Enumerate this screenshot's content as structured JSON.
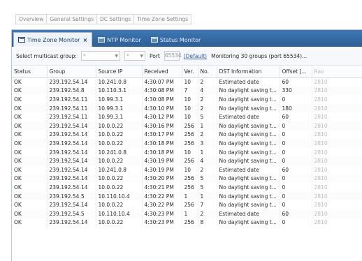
{
  "top_tabs": [
    "Overview",
    "General Settings",
    "DC Settings",
    "Time Zone Settings"
  ],
  "inner_tabs": [
    {
      "label": "Time Zone Monitor",
      "close": "×"
    },
    {
      "label": "NTP Monitor"
    },
    {
      "label": "Status Monitor"
    }
  ],
  "toolbar": {
    "select_label": "Select multicast group:",
    "combo1_value": "*",
    "combo2_value": "*",
    "port_label": "Port",
    "port_value": "65534",
    "default_link": "(Default)",
    "status_text": "Monitoring 30 groups (port 65534)..."
  },
  "table": {
    "columns": [
      "Status",
      "Group",
      "Source IP",
      "Received",
      "Ver.",
      "No.",
      "DST Information",
      "Offset [...",
      "Rav"
    ],
    "rows": [
      [
        "OK",
        "239.192.54.14",
        "10.241.0.8",
        "4:30:07 PM",
        "10",
        "2",
        "Estimated date",
        "60",
        "2810"
      ],
      [
        "OK",
        "239.192.54.8",
        "10.110.3.1",
        "4:30:08 PM",
        "7",
        "4",
        "No daylight saving t...",
        "330",
        "2810"
      ],
      [
        "OK",
        "239.192.54.11",
        "10.99.3.1",
        "4:30:08 PM",
        "10",
        "2",
        "No daylight saving t...",
        "0",
        "2810"
      ],
      [
        "OK",
        "239.192.54.11",
        "10.99.3.1",
        "4:30:10 PM",
        "10",
        "2",
        "No daylight saving t...",
        "180",
        "2810"
      ],
      [
        "OK",
        "239.192.54.11",
        "10.99.3.1",
        "4:30:12 PM",
        "10",
        "5",
        "Estimated date",
        "60",
        "2810"
      ],
      [
        "OK",
        "239.192.54.14",
        "10.0.0.22",
        "4:30:16 PM",
        "256",
        "1",
        "No daylight saving t...",
        "0",
        "2810"
      ],
      [
        "OK",
        "239.192.54.14",
        "10.0.0.22",
        "4:30:17 PM",
        "256",
        "2",
        "No daylight saving t...",
        "0",
        "2810"
      ],
      [
        "OK",
        "239.192.54.14",
        "10.0.0.22",
        "4:30:18 PM",
        "256",
        "3",
        "No daylight saving t...",
        "0",
        "2810"
      ],
      [
        "OK",
        "239.192.54.14",
        "10.241.0.8",
        "4:30:18 PM",
        "10",
        "1",
        "No daylight saving t...",
        "0",
        "2810"
      ],
      [
        "OK",
        "239.192.54.14",
        "10.0.0.22",
        "4:30:19 PM",
        "256",
        "4",
        "No daylight saving t...",
        "0",
        "2810"
      ],
      [
        "OK",
        "239.192.54.14",
        "10.241.0.8",
        "4:30:19 PM",
        "10",
        "2",
        "Estimated date",
        "60",
        "2810"
      ],
      [
        "OK",
        "239.192.54.14",
        "10.0.0.22",
        "4:30:20 PM",
        "256",
        "5",
        "No daylight saving t...",
        "0",
        "2810"
      ],
      [
        "OK",
        "239.192.54.14",
        "10.0.0.22",
        "4:30:21 PM",
        "256",
        "5",
        "No daylight saving t...",
        "0",
        "2810"
      ],
      [
        "OK",
        "239.192.54.5",
        "10.110.10.4",
        "4:30:22 PM",
        "1",
        "1",
        "No daylight saving t...",
        "0",
        "2810"
      ],
      [
        "OK",
        "239.192.54.14",
        "10.0.0.22",
        "4:30:22 PM",
        "256",
        "7",
        "No daylight saving t...",
        "0",
        "2810"
      ],
      [
        "OK",
        "239.192.54.5",
        "10.110.10.4",
        "4:30:23 PM",
        "1",
        "2",
        "Estimated date",
        "60",
        "2810"
      ],
      [
        "OK",
        "239.192.54.14",
        "10.0.0.22",
        "4:30:23 PM",
        "256",
        "8",
        "No daylight saving t...",
        "0",
        "2810"
      ]
    ]
  }
}
